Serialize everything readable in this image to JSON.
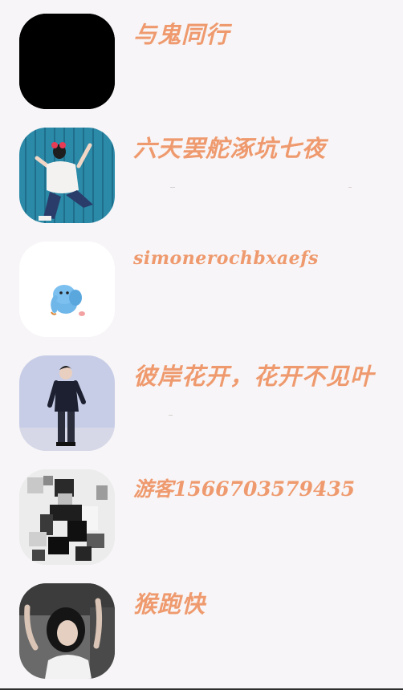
{
  "contacts": [
    {
      "name": "与鬼同行",
      "avatar": "black-avatar"
    },
    {
      "name": "六天罢舵涿坑七夜",
      "avatar": "girl-climbing-wall-avatar"
    },
    {
      "name": "simonerochbxaefs",
      "avatar": "blue-cartoon-elephant-avatar"
    },
    {
      "name": "彼岸花开，花开不见叶",
      "avatar": "man-standing-avatar"
    },
    {
      "name": "游客1566703579435",
      "avatar": "pixelated-man-avatar"
    },
    {
      "name": "猴跑快",
      "avatar": "woman-in-car-avatar"
    }
  ],
  "colors": {
    "background": "#f7f5f7",
    "name_text": "#ef9a6e"
  }
}
